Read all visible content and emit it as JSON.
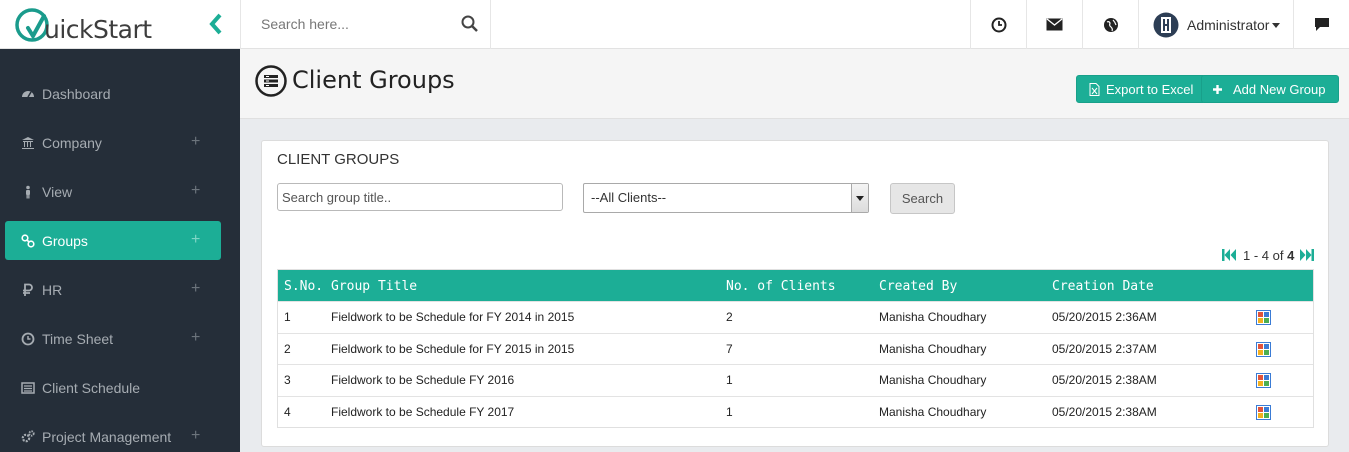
{
  "app": {
    "brand_q": "Q",
    "brand_rest": "uickStart"
  },
  "header": {
    "search_placeholder": "Search here...",
    "user_name": "Administrator"
  },
  "sidebar": {
    "items": [
      {
        "label": "Dashboard",
        "icon": "dashboard-icon",
        "has_plus": false,
        "active": false
      },
      {
        "label": "Company",
        "icon": "bank-icon",
        "has_plus": true,
        "active": false
      },
      {
        "label": "View",
        "icon": "person-icon",
        "has_plus": true,
        "active": false
      },
      {
        "label": "Groups",
        "icon": "link-icon",
        "has_plus": true,
        "active": true
      },
      {
        "label": "HR",
        "icon": "ruble-icon",
        "has_plus": true,
        "active": false
      },
      {
        "label": "Time Sheet",
        "icon": "clock-icon",
        "has_plus": true,
        "active": false
      },
      {
        "label": "Client Schedule",
        "icon": "list-icon",
        "has_plus": false,
        "active": false
      },
      {
        "label": "Project Management",
        "icon": "cogs-icon",
        "has_plus": true,
        "active": false
      }
    ],
    "plus": "+"
  },
  "page": {
    "title": "Client Groups",
    "export_label": "Export to Excel",
    "add_label": "Add New Group"
  },
  "card": {
    "heading": "CLIENT GROUPS",
    "search_placeholder": "Search group title..",
    "client_select": "--All Clients--",
    "search_button": "Search",
    "pager_range": "1 - 4 of ",
    "pager_total": "4"
  },
  "table": {
    "headers": [
      "S.No.",
      "Group Title",
      "No. of Clients",
      "Created By",
      "Creation Date"
    ],
    "rows": [
      {
        "sno": "1",
        "title": "Fieldwork to be Schedule for FY 2014 in 2015",
        "clients": "2",
        "created_by": "Manisha Choudhary",
        "date": "05/20/2015 2:36AM"
      },
      {
        "sno": "2",
        "title": "Fieldwork to be Schedule for FY 2015 in 2015",
        "clients": "7",
        "created_by": "Manisha Choudhary",
        "date": "05/20/2015 2:37AM"
      },
      {
        "sno": "3",
        "title": "Fieldwork to be Schedule FY 2016",
        "clients": "1",
        "created_by": "Manisha Choudhary",
        "date": "05/20/2015 2:38AM"
      },
      {
        "sno": "4",
        "title": "Fieldwork to be Schedule FY 2017",
        "clients": "1",
        "created_by": "Manisha Choudhary",
        "date": "05/20/2015 2:38AM"
      }
    ]
  },
  "colors": {
    "accent": "#1cae96",
    "sidebar_bg": "#252e39"
  }
}
